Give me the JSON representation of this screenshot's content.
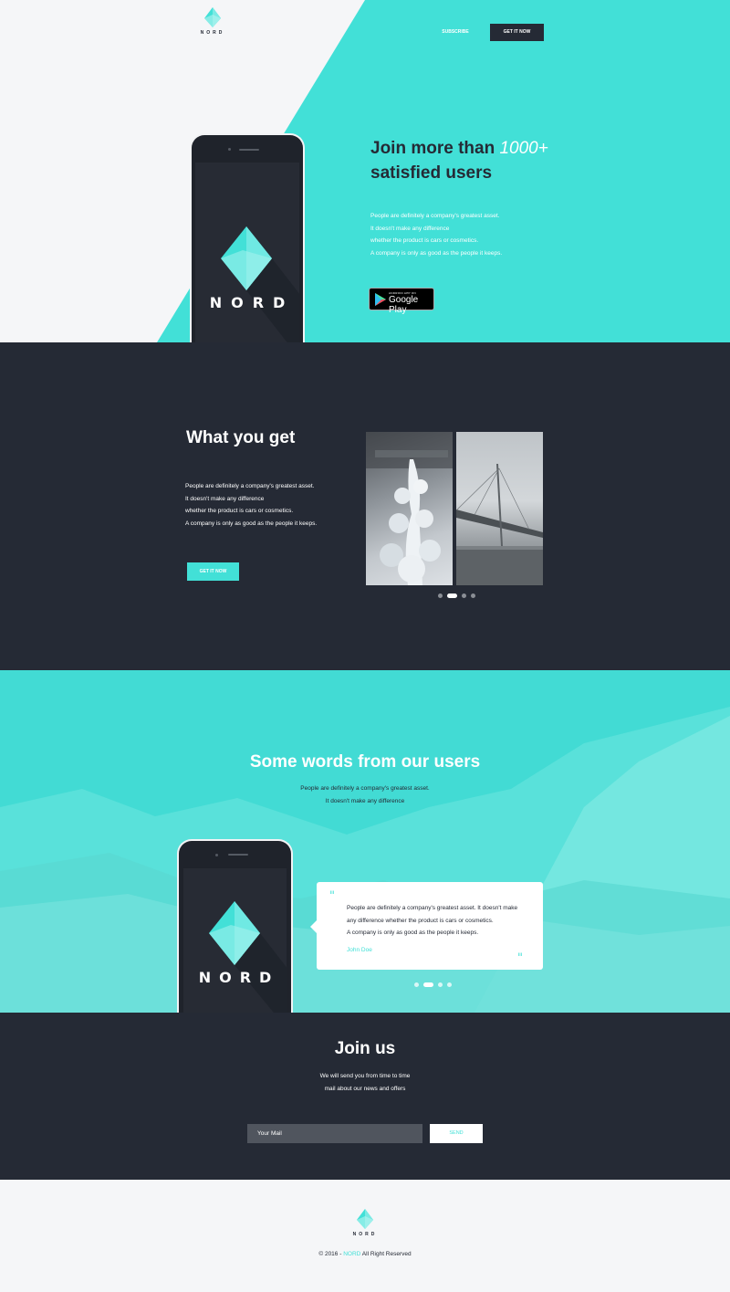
{
  "colors": {
    "accent": "#42e0d7",
    "dark": "#252a35",
    "light": "#f5f6f8"
  },
  "brand": {
    "name": "NORD",
    "icon": "diamond-logo-icon"
  },
  "nav": {
    "subscribe": "SUBSCRIBE",
    "get_it_now": "GET IT NOW"
  },
  "hero": {
    "title_prefix": "Join more than",
    "title_highlight": "1000+",
    "title_suffix": "satisfied users",
    "description": [
      "People are definitely a company's greatest asset.",
      "It doesn't make any difference",
      "whether the product is cars or cosmetics.",
      "A company is only as good as the people it keeps."
    ],
    "store_badge": {
      "small": "ANDROID APP ON",
      "big": "Google Play",
      "icon": "google-play-icon"
    }
  },
  "features": {
    "title": "What you get",
    "description": [
      "People are definitely a company's greatest asset.",
      "It doesn't make any difference",
      "whether the product is cars or cosmetics.",
      "A company is only as good as the people it keeps."
    ],
    "button": "GET IT NOW",
    "slider": {
      "count": 4,
      "active": 2
    }
  },
  "testimonials": {
    "title": "Some words from our users",
    "subtitle": [
      "People are definitely a company's greatest asset.",
      "It doesn't make any difference"
    ],
    "quote": [
      "People are definitely a company's greatest asset. It doesn't make",
      "any difference whether the product is cars or cosmetics.",
      "A company is only as good as the people it keeps."
    ],
    "author": "John Doe",
    "slider": {
      "count": 4,
      "active": 2
    }
  },
  "join": {
    "title": "Join us",
    "subtitle": [
      "We will send you from time to time",
      "mail about our news and offers"
    ],
    "input_placeholder": "Your Mail",
    "button": "SEND"
  },
  "footer": {
    "copyright_prefix": "© 2016 -",
    "copyright_brand": "NORD",
    "copyright_suffix": "All Right Reserved"
  }
}
